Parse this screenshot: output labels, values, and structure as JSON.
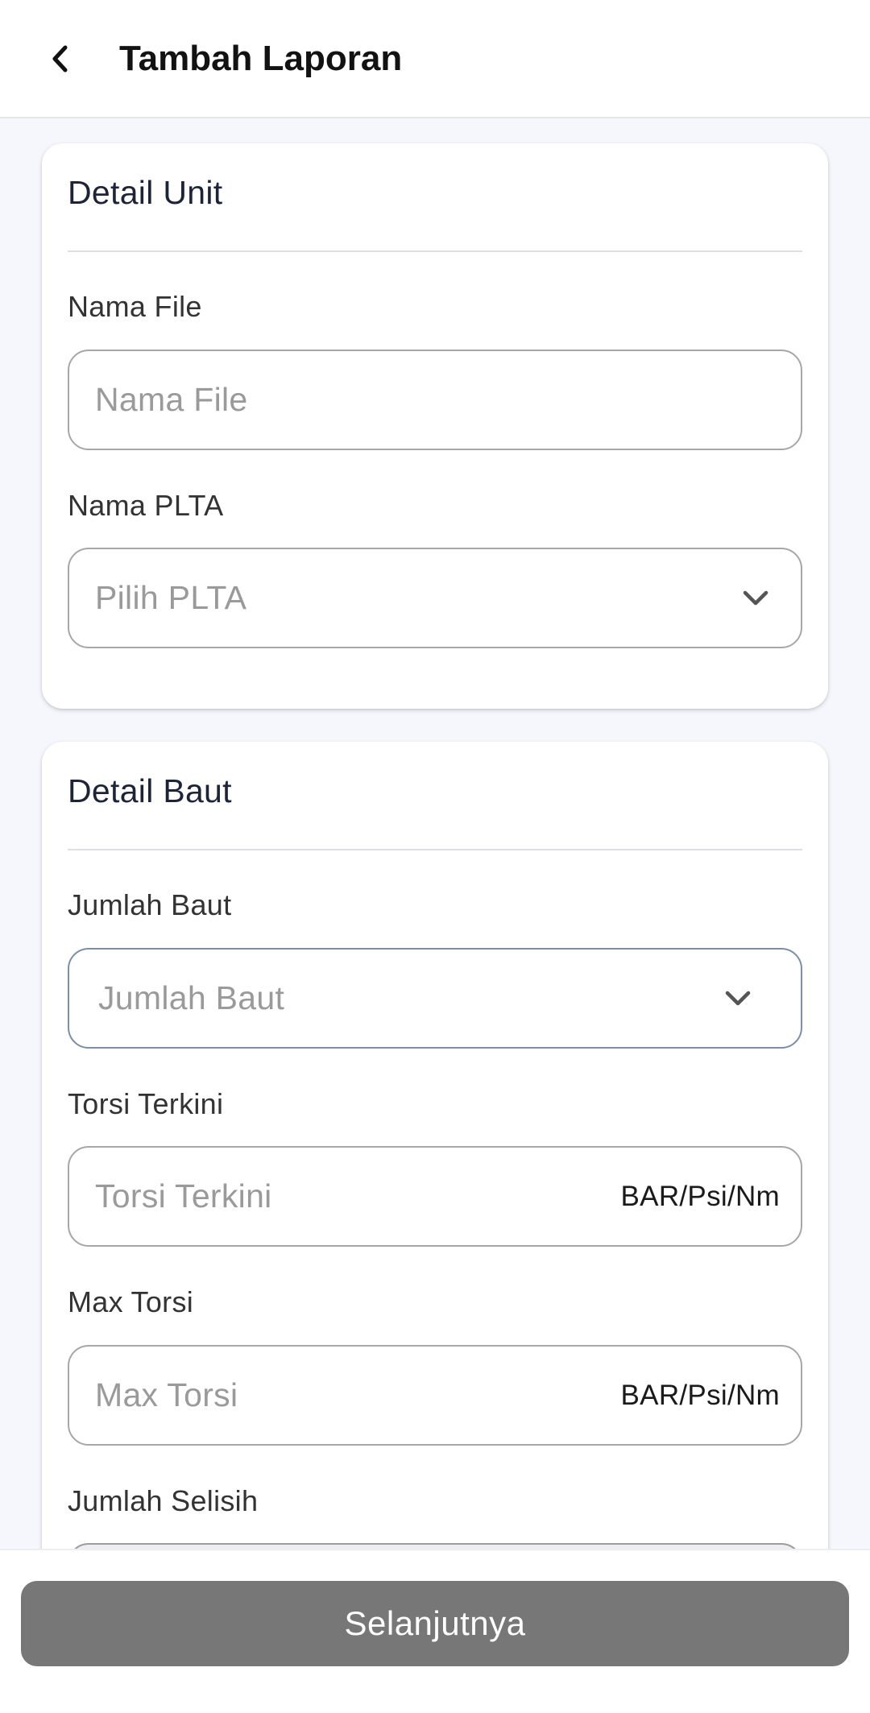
{
  "header": {
    "title": "Tambah Laporan",
    "back_icon": "chevron-left-icon"
  },
  "unit_card": {
    "title": "Detail Unit",
    "nama_file": {
      "label": "Nama File",
      "placeholder": "Nama File"
    },
    "nama_plta": {
      "label": "Nama PLTA",
      "placeholder": "Pilih PLTA",
      "icon": "chevron-down-icon"
    }
  },
  "baut_card": {
    "title": "Detail Baut",
    "jumlah_baut": {
      "label": "Jumlah Baut",
      "placeholder": "Jumlah Baut",
      "icon": "chevron-down-icon"
    },
    "torsi_terkini": {
      "label": "Torsi Terkini",
      "placeholder": "Torsi Terkini",
      "unit": "BAR/Psi/Nm"
    },
    "max_torsi": {
      "label": "Max Torsi",
      "placeholder": "Max Torsi",
      "unit": "BAR/Psi/Nm"
    },
    "jumlah_selisih": {
      "label": "Jumlah Selisih"
    }
  },
  "footer": {
    "next_label": "Selanjutnya"
  },
  "colors": {
    "background": "#f6f7fc",
    "button": "#777777",
    "border": "#a7a7a7",
    "placeholder": "#9a9a9a",
    "title": "#1d2437"
  }
}
